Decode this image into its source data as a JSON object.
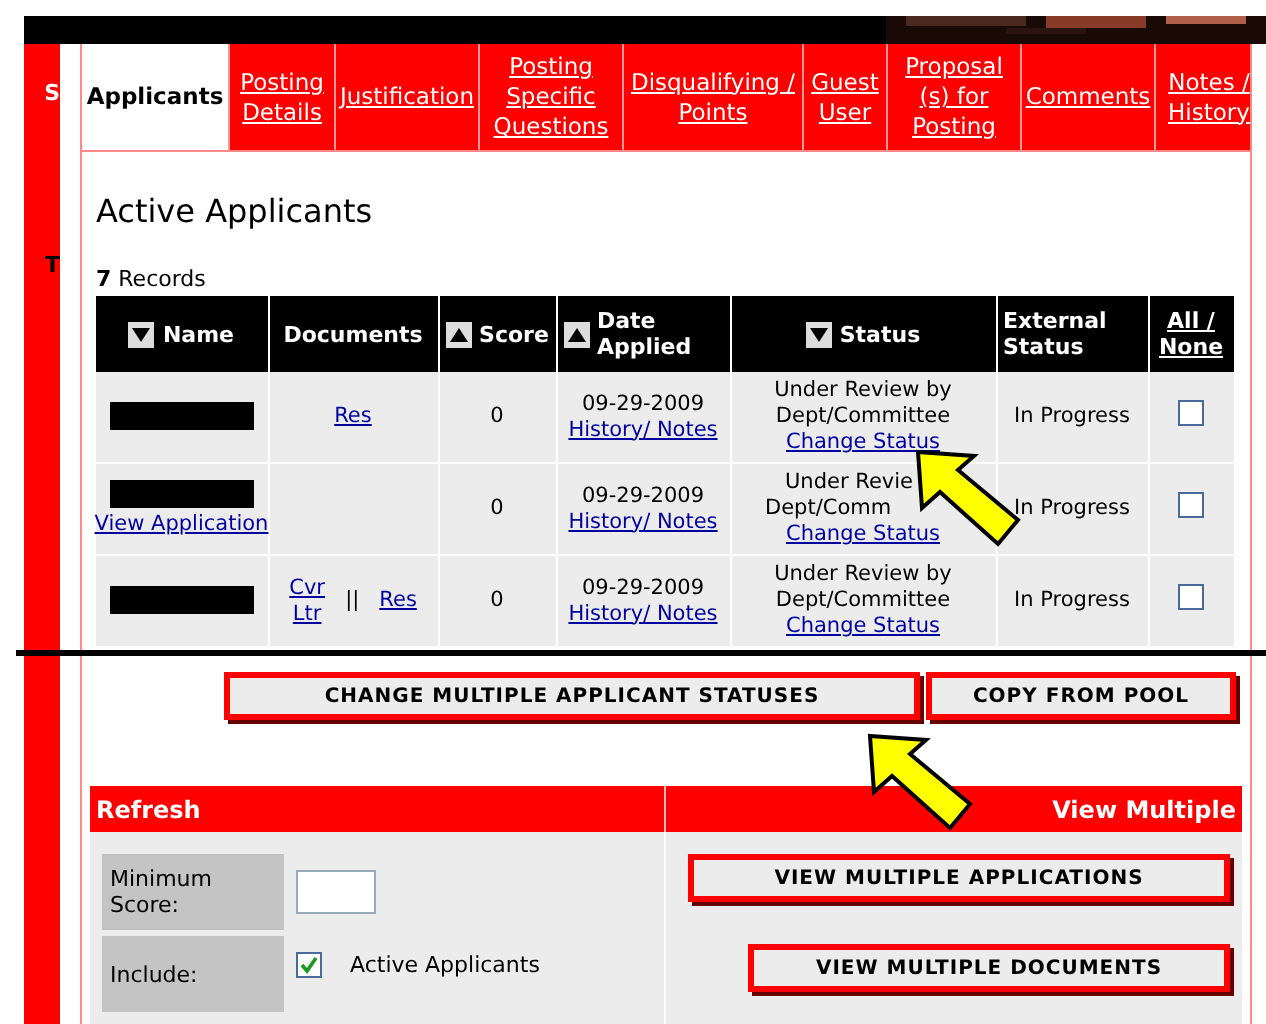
{
  "sidebar_fragments": [
    {
      "label": "S"
    },
    {
      "label": "T"
    }
  ],
  "tabs": [
    {
      "label": "Applicants",
      "selected": true
    },
    {
      "label": "Posting Details",
      "selected": false
    },
    {
      "label": "Justification",
      "selected": false
    },
    {
      "label": "Posting Specific Questions",
      "selected": false
    },
    {
      "label": "Disqualifying / Points",
      "selected": false
    },
    {
      "label": "Guest User",
      "selected": false
    },
    {
      "label": "Proposal (s) for Posting",
      "selected": false
    },
    {
      "label": "Comments",
      "selected": false
    },
    {
      "label": "Notes / History",
      "selected": false
    }
  ],
  "heading": "Active Applicants",
  "record_count": "7",
  "record_label": "Records",
  "table": {
    "columns": [
      {
        "label": "Name",
        "sortable": true,
        "sort_up": false
      },
      {
        "label": "Documents",
        "sortable": false
      },
      {
        "label": "Score",
        "sortable": true,
        "sort_up": true
      },
      {
        "label": "Date Applied",
        "sortable": true,
        "sort_up": true
      },
      {
        "label": "Status",
        "sortable": true,
        "sort_up": false
      },
      {
        "label": "External Status",
        "sortable": false
      },
      {
        "label": "All / None",
        "sortable": false,
        "kind": "link"
      }
    ],
    "rows": [
      {
        "documents": [
          "Res"
        ],
        "score": "0",
        "date": "09-29-2009",
        "history": "History/ Notes",
        "status": "Under Review by Dept/Committee",
        "change": "Change Status",
        "external": "In Progress",
        "checked": false
      },
      {
        "view_application": "View Application",
        "documents": [],
        "score": "0",
        "date": "09-29-2009",
        "history": "History/ Notes",
        "status": "Under Revie",
        "status_line_2": "Dept/Comm",
        "change": "Change Status",
        "external": "In Progress",
        "checked": false
      },
      {
        "documents": [
          "Cvr Ltr",
          "Res"
        ],
        "doc_separator": "||",
        "score": "0",
        "date": "09-29-2009",
        "history": "History/ Notes",
        "status": "Under Review by Dept/Committee",
        "change": "Change Status",
        "external": "In Progress",
        "checked": false
      }
    ]
  },
  "action_buttons": [
    "CHANGE MULTIPLE APPLICANT STATUSES",
    "COPY FROM POOL"
  ],
  "refresh": {
    "title": "Refresh",
    "min_score_label": "Minimum Score:",
    "include_label": "Include:",
    "include_options": [
      {
        "label": "Active Applicants",
        "checked": true
      }
    ]
  },
  "view_multiple": {
    "title": "View Multiple",
    "buttons": [
      "VIEW MULTIPLE APPLICATIONS",
      "VIEW MULTIPLE DOCUMENTS"
    ]
  }
}
